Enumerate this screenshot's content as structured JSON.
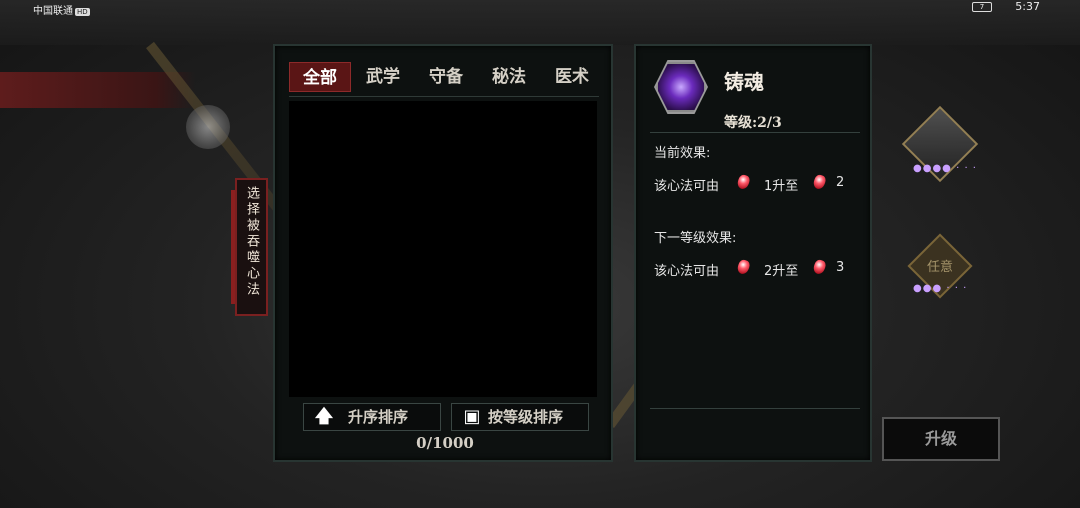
{
  "status_bar": {
    "carrier": "中国联通",
    "hd": "HD",
    "battery": "7",
    "time": "5:37"
  },
  "side_label": "选择被吞噬心法",
  "tabs": [
    {
      "label": "全部",
      "active": true
    },
    {
      "label": "武学",
      "active": false
    },
    {
      "label": "守备",
      "active": false
    },
    {
      "label": "秘法",
      "active": false
    },
    {
      "label": "医术",
      "active": false
    }
  ],
  "sort": {
    "ascending_label": "升序排序",
    "by_level_label": "按等级排序"
  },
  "count": "0/1000",
  "skill": {
    "name": "铸魂",
    "level": "等级:2/3",
    "current_effect_title": "当前效果:",
    "current_effect": {
      "prefix": "该心法可由",
      "middle": "1升至",
      "suffix": "2"
    },
    "next_effect_title": "下一等级效果:",
    "next_effect": {
      "prefix": "该心法可由",
      "middle": "2升至",
      "suffix": "3"
    }
  },
  "right_side": {
    "any_label": "任意"
  },
  "upgrade_label": "升级",
  "colors": {
    "accent_red": "#5a1515",
    "gem_red": "#ff3344",
    "skill_purple": "#6b2bbd"
  }
}
